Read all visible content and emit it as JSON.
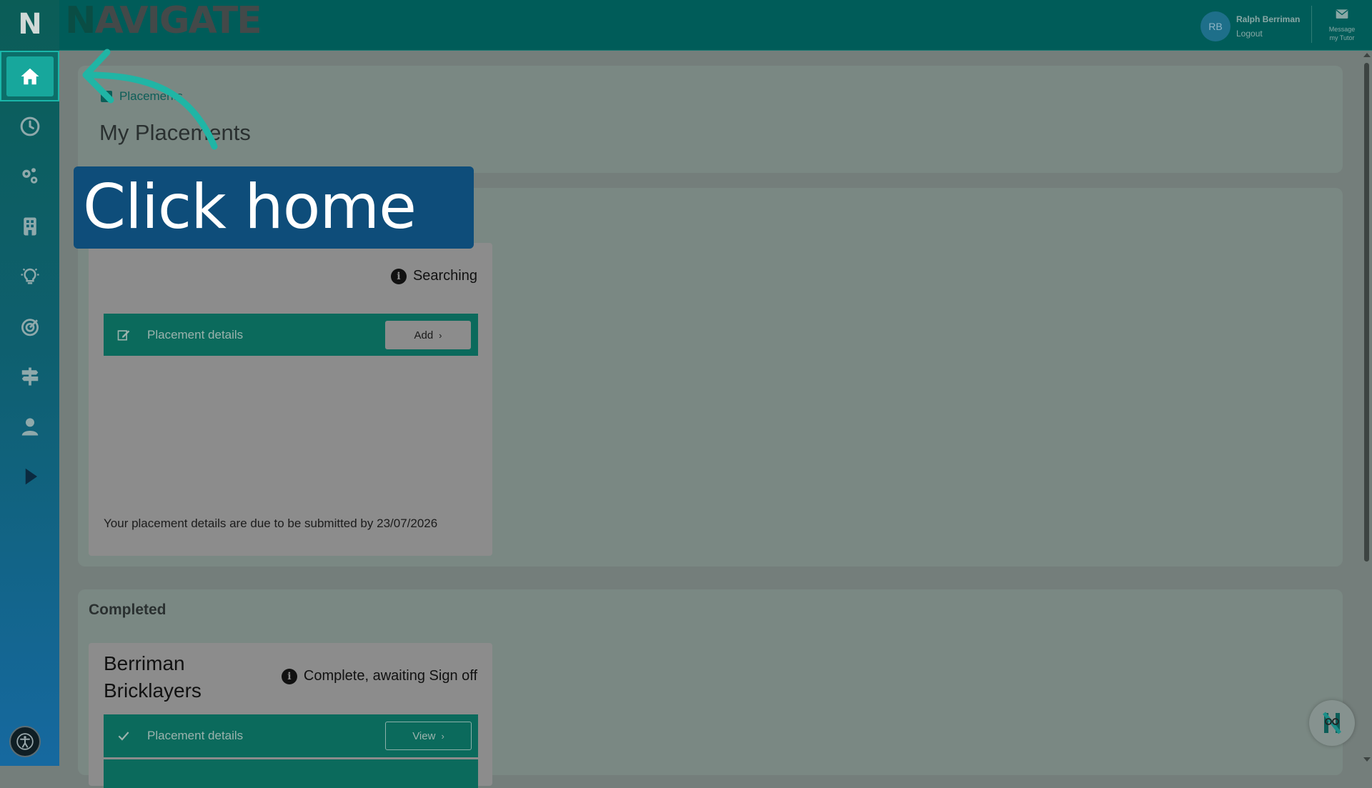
{
  "app": {
    "brand_initial": "N",
    "brand_rest": "AVIGATE",
    "logo_letter": "N"
  },
  "user": {
    "initials": "RB",
    "name": "Ralph Berriman",
    "logout_label": "Logout",
    "message_line1": "Message",
    "message_line2": "my Tutor"
  },
  "sidebar": {
    "items": [
      {
        "icon": "home-icon",
        "active": true
      },
      {
        "icon": "clock-icon"
      },
      {
        "icon": "gears-icon"
      },
      {
        "icon": "building-icon"
      },
      {
        "icon": "lightbulb-icon"
      },
      {
        "icon": "target-arrow-icon"
      },
      {
        "icon": "signpost-icon"
      },
      {
        "icon": "user-icon"
      },
      {
        "icon": "play-icon"
      }
    ],
    "accessibility_icon": "accessibility-icon"
  },
  "breadcrumb": {
    "label": "Placements"
  },
  "page": {
    "title": "My Placements"
  },
  "current": {
    "status": "Searching",
    "detail_label": "Placement details",
    "add_label": "Add",
    "due_text": "Your placement details are due to be submitted by 23/07/2026"
  },
  "completed": {
    "heading": "Completed",
    "company_line1": "Berriman",
    "company_line2": "Bricklayers",
    "status": "Complete, awaiting Sign off",
    "detail_label": "Placement details",
    "view_label": "View"
  },
  "tutorial": {
    "callout_text": "Click home"
  },
  "colors": {
    "topbar": "#005c59",
    "accent": "#17a79c",
    "callout": "#0e4d7a",
    "arrow": "#20b5a5"
  }
}
